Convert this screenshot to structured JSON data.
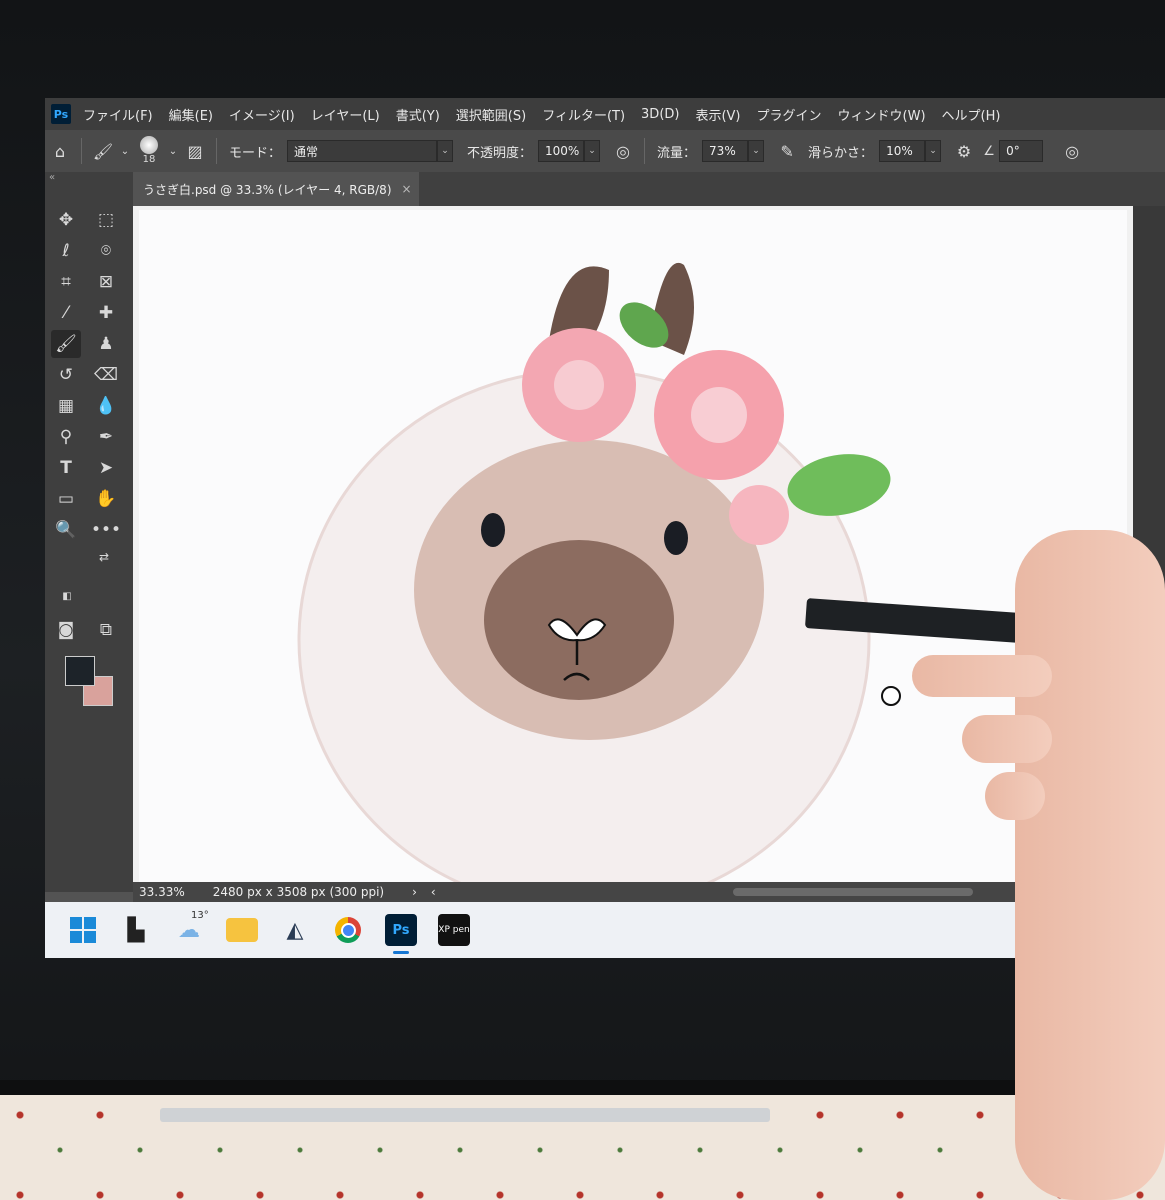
{
  "menu": {
    "app_icon": "Ps",
    "items": [
      "ファイル(F)",
      "編集(E)",
      "イメージ(I)",
      "レイヤー(L)",
      "書式(Y)",
      "選択範囲(S)",
      "フィルター(T)",
      "3D(D)",
      "表示(V)",
      "プラグイン",
      "ウィンドウ(W)",
      "ヘルプ(H)"
    ]
  },
  "options": {
    "brush_size": "18",
    "mode_label": "モード：",
    "mode_value": "通常",
    "opacity_label": "不透明度：",
    "opacity_value": "100%",
    "flow_label": "流量：",
    "flow_value": "73%",
    "smoothing_label": "滑らかさ：",
    "smoothing_value": "10%",
    "angle_value": "0°"
  },
  "document": {
    "tab_title": "うさぎ白.psd @ 33.3% (レイヤー 4, RGB/8)",
    "close_glyph": "×"
  },
  "status": {
    "zoom": "33.33%",
    "doc_info": "2480 px x 3508 px (300 ppi)",
    "arrow_right": "›",
    "arrow_left": "‹"
  },
  "colors": {
    "foreground": "#1d2329",
    "background": "#d9a29c",
    "accent": "#31a8ff"
  },
  "taskbar": {
    "weather_temp": "13°",
    "photoshop_label": "Ps",
    "xppen_label": "XP pen",
    "icons": [
      "windows-start-icon",
      "launcher-icon",
      "weather-icon",
      "file-explorer-icon",
      "app-cube-icon",
      "chrome-icon",
      "photoshop-icon",
      "xppen-icon"
    ]
  }
}
